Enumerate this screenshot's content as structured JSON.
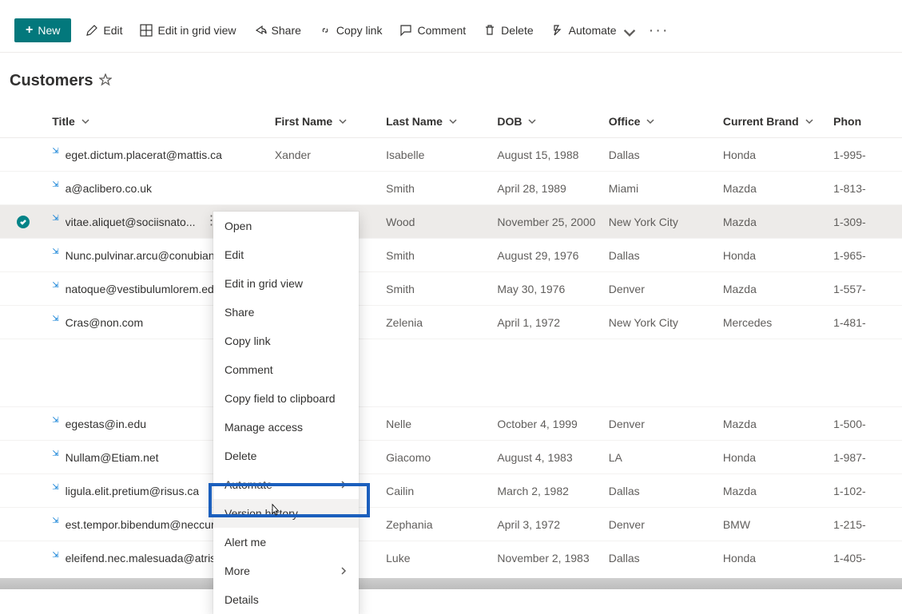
{
  "toolbar": {
    "new_label": "New",
    "edit_label": "Edit",
    "edit_grid_label": "Edit in grid view",
    "share_label": "Share",
    "copylink_label": "Copy link",
    "comment_label": "Comment",
    "delete_label": "Delete",
    "automate_label": "Automate"
  },
  "list": {
    "title": "Customers"
  },
  "columns": {
    "title": "Title",
    "first": "First Name",
    "last": "Last Name",
    "dob": "DOB",
    "office": "Office",
    "brand": "Current Brand",
    "phone": "Phon"
  },
  "rows": [
    {
      "title": "eget.dictum.placerat@mattis.ca",
      "first": "Xander",
      "last": "Isabelle",
      "dob": "August 15, 1988",
      "office": "Dallas",
      "brand": "Honda",
      "phone": "1-995-"
    },
    {
      "title": "a@aclibero.co.uk",
      "first": "",
      "last": "Smith",
      "dob": "April 28, 1989",
      "office": "Miami",
      "brand": "Mazda",
      "phone": "1-813-"
    },
    {
      "title": "vitae.aliquet@sociisnato...",
      "first": "",
      "last": "Wood",
      "dob": "November 25, 2000",
      "office": "New York City",
      "brand": "Mazda",
      "phone": "1-309-"
    },
    {
      "title": "Nunc.pulvinar.arcu@conubianostr",
      "first": "",
      "last": "Smith",
      "dob": "August 29, 1976",
      "office": "Dallas",
      "brand": "Honda",
      "phone": "1-965-"
    },
    {
      "title": "natoque@vestibulumlorem.edu",
      "first": "",
      "last": "Smith",
      "dob": "May 30, 1976",
      "office": "Denver",
      "brand": "Mazda",
      "phone": "1-557-"
    },
    {
      "title": "Cras@non.com",
      "first": "",
      "last": "Zelenia",
      "dob": "April 1, 1972",
      "office": "New York City",
      "brand": "Mercedes",
      "phone": "1-481-"
    },
    {
      "title": "egestas@in.edu",
      "first": "",
      "last": "Nelle",
      "dob": "October 4, 1999",
      "office": "Denver",
      "brand": "Mazda",
      "phone": "1-500-"
    },
    {
      "title": "Nullam@Etiam.net",
      "first": "",
      "last": "Giacomo",
      "dob": "August 4, 1983",
      "office": "LA",
      "brand": "Honda",
      "phone": "1-987-"
    },
    {
      "title": "ligula.elit.pretium@risus.ca",
      "first": "",
      "last": "Cailin",
      "dob": "March 2, 1982",
      "office": "Dallas",
      "brand": "Mazda",
      "phone": "1-102-"
    },
    {
      "title": "est.tempor.bibendum@neccursus",
      "first": "",
      "last": "Zephania",
      "dob": "April 3, 1972",
      "office": "Denver",
      "brand": "BMW",
      "phone": "1-215-"
    },
    {
      "title": "eleifend.nec.malesuada@atrisus.c",
      "first": "",
      "last": "Luke",
      "dob": "November 2, 1983",
      "office": "Dallas",
      "brand": "Honda",
      "phone": "1-405-"
    }
  ],
  "context_menu": {
    "open": "Open",
    "edit": "Edit",
    "edit_grid": "Edit in grid view",
    "share": "Share",
    "copy_link": "Copy link",
    "comment": "Comment",
    "copy_field": "Copy field to clipboard",
    "manage_access": "Manage access",
    "delete": "Delete",
    "automate": "Automate",
    "version_history": "Version history",
    "alert_me": "Alert me",
    "more": "More",
    "details": "Details"
  }
}
